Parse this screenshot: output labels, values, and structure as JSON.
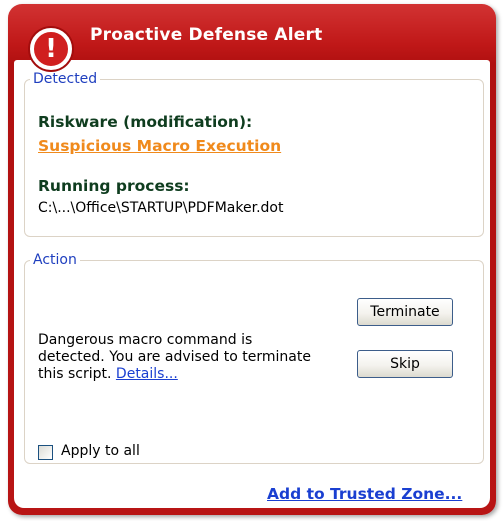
{
  "window": {
    "title": "Proactive Defense Alert",
    "alert_icon_glyph": "!",
    "alert_icon": "alert-exclamation-icon"
  },
  "detected": {
    "legend": "Detected",
    "threat_type_label": "Riskware (modification):",
    "threat_name": "Suspicious Macro Execution",
    "process_label": "Running process:",
    "process_path": "C:\\...\\Office\\STARTUP\\PDFMaker.dot"
  },
  "action": {
    "legend": "Action",
    "description": "Dangerous macro command is detected. You are advised to terminate this script.",
    "details_link": "Details...",
    "terminate_label": "Terminate",
    "skip_label": "Skip",
    "apply_to_all_label": "Apply to all",
    "apply_to_all_checked": false
  },
  "footer": {
    "trusted_zone_link": "Add to Trusted Zone..."
  },
  "colors": {
    "frame_red": "#c01818",
    "legend_blue": "#1f3fbf",
    "threat_orange": "#f08a1c",
    "link_blue": "#1a3fd1",
    "label_dark_green": "#0f3d1f"
  }
}
